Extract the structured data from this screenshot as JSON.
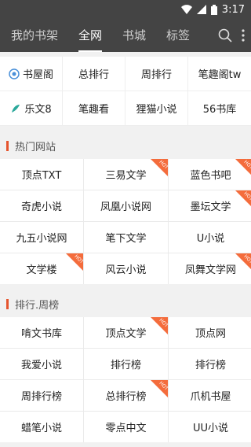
{
  "status": {
    "time": "3:17"
  },
  "nav": {
    "tabs": [
      {
        "label": "我的书架",
        "active": false
      },
      {
        "label": "全网",
        "active": true
      },
      {
        "label": "书城",
        "active": false
      },
      {
        "label": "标签",
        "active": false
      }
    ],
    "search_icon": "search-icon",
    "more_icon": "more-vertical-icon"
  },
  "quick_links": {
    "row1": [
      "书屋阁",
      "总排行",
      "周排行",
      "笔趣阁tw"
    ],
    "row2": [
      "乐文8",
      "笔趣看",
      "狸猫小说",
      "56书库"
    ]
  },
  "sections": {
    "hot_sites": {
      "title": "热门网站",
      "badge": "HOT",
      "items": [
        {
          "label": "顶点TXT",
          "hot": false
        },
        {
          "label": "三易文学",
          "hot": true
        },
        {
          "label": "蓝色书吧",
          "hot": true
        },
        {
          "label": "奇虎小说",
          "hot": false
        },
        {
          "label": "凤凰小说网",
          "hot": false
        },
        {
          "label": "墨坛文学",
          "hot": true
        },
        {
          "label": "九五小说网",
          "hot": false
        },
        {
          "label": "笔下文学",
          "hot": false
        },
        {
          "label": "U小说",
          "hot": false
        },
        {
          "label": "文学楼",
          "hot": true
        },
        {
          "label": "风云小说",
          "hot": false
        },
        {
          "label": "凤舞文学网",
          "hot": true
        }
      ]
    },
    "rankings": {
      "title": "排行.周榜",
      "badge": "HOT",
      "items": [
        {
          "label": "啃文书库",
          "hot": false
        },
        {
          "label": "顶点文学",
          "hot": true
        },
        {
          "label": "顶点网",
          "hot": false
        },
        {
          "label": "我爱小说",
          "hot": false
        },
        {
          "label": "排行榜",
          "hot": false
        },
        {
          "label": "排行榜",
          "hot": false
        },
        {
          "label": "周排行榜",
          "hot": false
        },
        {
          "label": "总排行榜",
          "hot": true
        },
        {
          "label": "爪机书屋",
          "hot": false
        },
        {
          "label": "蜡笔小说",
          "hot": false
        },
        {
          "label": "零点中文",
          "hot": false
        },
        {
          "label": "UU小说",
          "hot": false
        }
      ]
    }
  },
  "colors": {
    "nav_bg": "#444444",
    "accent": "#e5542d",
    "hot_badge": "#f46c3c"
  }
}
